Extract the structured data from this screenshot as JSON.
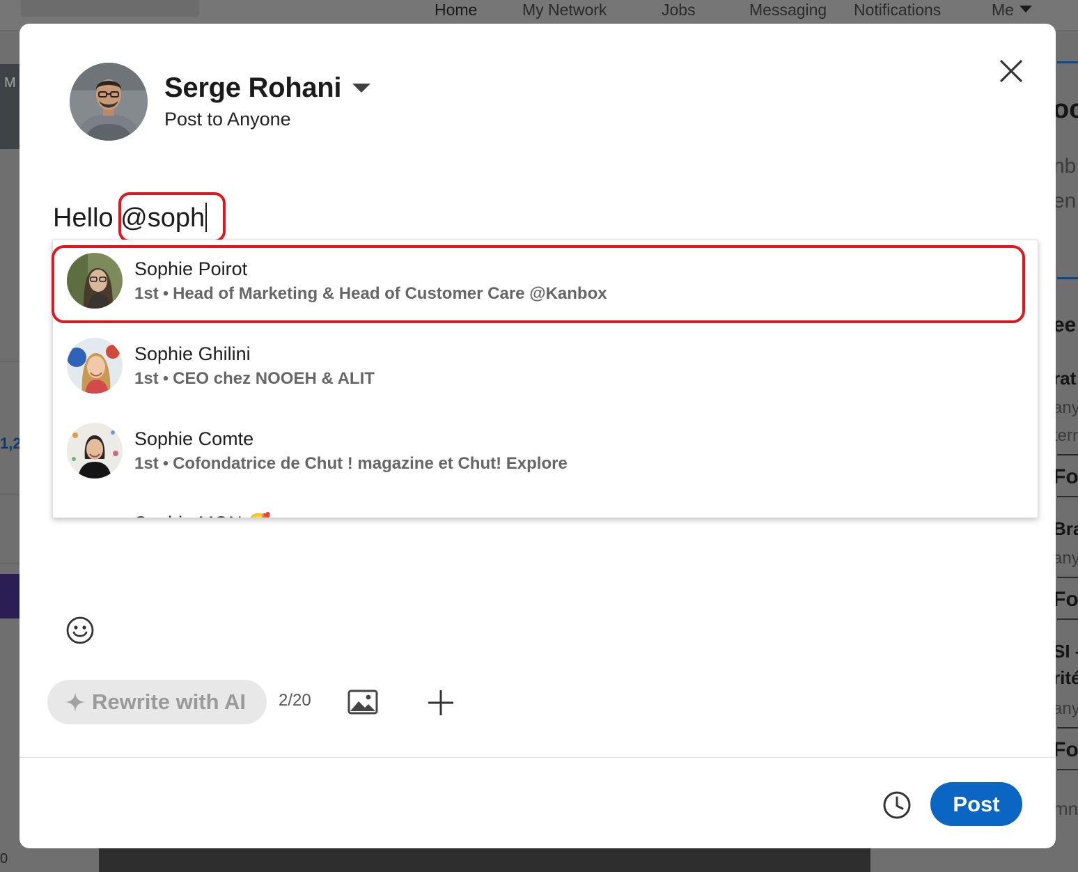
{
  "background_nav": {
    "items": [
      "Home",
      "My Network",
      "Jobs",
      "Messaging",
      "Notifications"
    ],
    "me_label": "Me",
    "left_card_letter": "M",
    "left_count_fragment": "1,2",
    "left_bottom_fragment": "0",
    "right_fragments": [
      "oc",
      "nb",
      "en",
      "ee",
      "rat",
      "any",
      "tern",
      "Fo",
      "Bra",
      "any",
      "Fo",
      "SI –",
      "rité",
      "any",
      "Fo",
      "mn"
    ]
  },
  "composer": {
    "author_name": "Serge Rohani",
    "audience": "Post to Anyone",
    "text_before": "Hello ",
    "mention_query": "@soph",
    "suggestions": [
      {
        "name": "Sophie Poirot",
        "degree": "1st",
        "headline": "Head of Marketing & Head of Customer Care @Kanbox"
      },
      {
        "name": "Sophie Ghilini",
        "degree": "1st",
        "headline": "CEO chez NOOEH & ALIT"
      },
      {
        "name": "Sophie Comte",
        "degree": "1st",
        "headline": "Cofondatrice de Chut ! magazine et Chut! Explore"
      }
    ],
    "partial_suggestion": "Sophie MON 🥰",
    "rewrite_label": "Rewrite with AI",
    "counter": "2/20",
    "post_label": "Post"
  },
  "icons": {
    "close": "close-icon",
    "emoji": "emoji-icon",
    "sparkle": "sparkle-icon",
    "image": "image-icon",
    "plus": "plus-icon",
    "clock": "clock-icon"
  },
  "colors": {
    "accent": "#0a66c2",
    "highlight": "#e3161e",
    "overlay": "#6f6f6f"
  }
}
